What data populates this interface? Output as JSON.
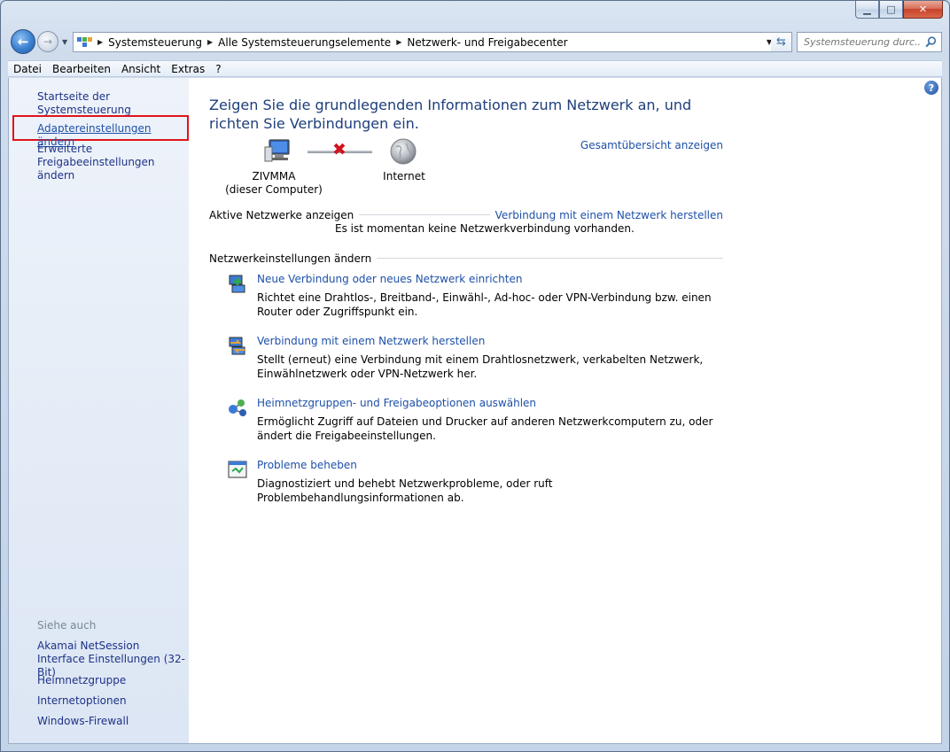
{
  "window": {
    "caption_buttons": [
      "minimize",
      "maximize",
      "close"
    ]
  },
  "navbar": {
    "breadcrumb": [
      "Systemsteuerung",
      "Alle Systemsteuerungselemente",
      "Netzwerk- und Freigabecenter"
    ],
    "search_placeholder": "Systemsteuerung durc..."
  },
  "menu": [
    "Datei",
    "Bearbeiten",
    "Ansicht",
    "Extras",
    "?"
  ],
  "sidebar": {
    "home": "Startseite der Systemsteuerung",
    "adapter": "Adaptereinstellungen ändern",
    "advanced": "Erweiterte Freigabeeinstellungen ändern",
    "see_also": "Siehe auch",
    "see_also_items": [
      "Akamai NetSession Interface Einstellungen (32-Bit)",
      "Heimnetzgruppe",
      "Internetoptionen",
      "Windows-Firewall"
    ]
  },
  "main": {
    "title": "Zeigen Sie die grundlegenden Informationen zum Netzwerk an, und richten Sie Verbindungen ein.",
    "overview_link": "Gesamtübersicht anzeigen",
    "computer_name": "ZIVMMA",
    "computer_sub": "(dieser Computer)",
    "internet_label": "Internet",
    "active_networks_label": "Aktive Netzwerke anzeigen",
    "connect_link": "Verbindung mit einem Netzwerk herstellen",
    "no_connection": "Es ist momentan keine Netzwerkverbindung vorhanden.",
    "settings_label": "Netzwerkeinstellungen ändern",
    "tasks": [
      {
        "title": "Neue Verbindung oder neues Netzwerk einrichten",
        "desc": "Richtet eine Drahtlos-, Breitband-, Einwähl-, Ad-hoc- oder VPN-Verbindung bzw. einen Router oder Zugriffspunkt ein.",
        "icon": "new-connection-icon"
      },
      {
        "title": "Verbindung mit einem Netzwerk herstellen",
        "desc": "Stellt (erneut) eine Verbindung mit einem Drahtlosnetzwerk, verkabelten Netzwerk, Einwählnetzwerk oder VPN-Netzwerk her.",
        "icon": "connect-network-icon"
      },
      {
        "title": "Heimnetzgruppen- und Freigabeoptionen auswählen",
        "desc": "Ermöglicht Zugriff auf Dateien und Drucker auf anderen Netzwerkcomputern zu, oder ändert die Freigabeeinstellungen.",
        "icon": "homegroup-icon"
      },
      {
        "title": "Probleme beheben",
        "desc": "Diagnostiziert und behebt Netzwerkprobleme, oder ruft Problembehandlungsinformationen ab.",
        "icon": "troubleshoot-icon"
      }
    ]
  },
  "colors": {
    "link": "#1d50a8",
    "title": "#1e3e7a",
    "highlight_frame": "#e0131b",
    "error_x": "#d2121d"
  }
}
